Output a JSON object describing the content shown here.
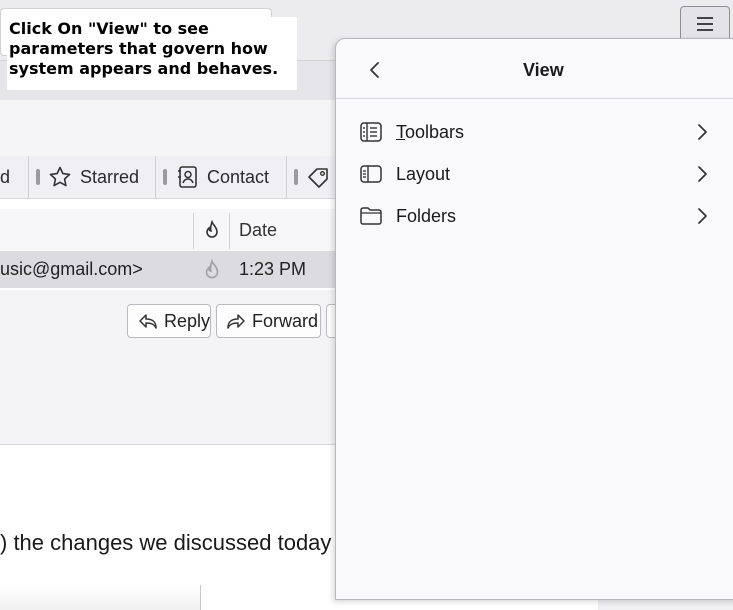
{
  "callout": {
    "text": "Click On \"View\" to see parameters that govern how system appears and behaves."
  },
  "quick_filter": {
    "partial_label": "d",
    "starred_label": "Starred",
    "contact_label": "Contact"
  },
  "thread_header": {
    "date_label": "Date"
  },
  "message_row": {
    "from": "usic@gmail.com>",
    "time": "1:23 PM"
  },
  "message_actions": {
    "reply_label": "Reply",
    "forward_label": "Forward"
  },
  "message_body": {
    "text": ") the changes we discussed today"
  },
  "app_menu": {
    "title": "View",
    "items": [
      {
        "label": "Toolbars",
        "icon": "toolbars-icon"
      },
      {
        "label": "Layout",
        "icon": "layout-icon"
      },
      {
        "label": "Folders",
        "icon": "folder-icon"
      }
    ]
  },
  "colors": {
    "panel_bg": "#f9f9fb",
    "selected_row": "#dcdce0"
  }
}
